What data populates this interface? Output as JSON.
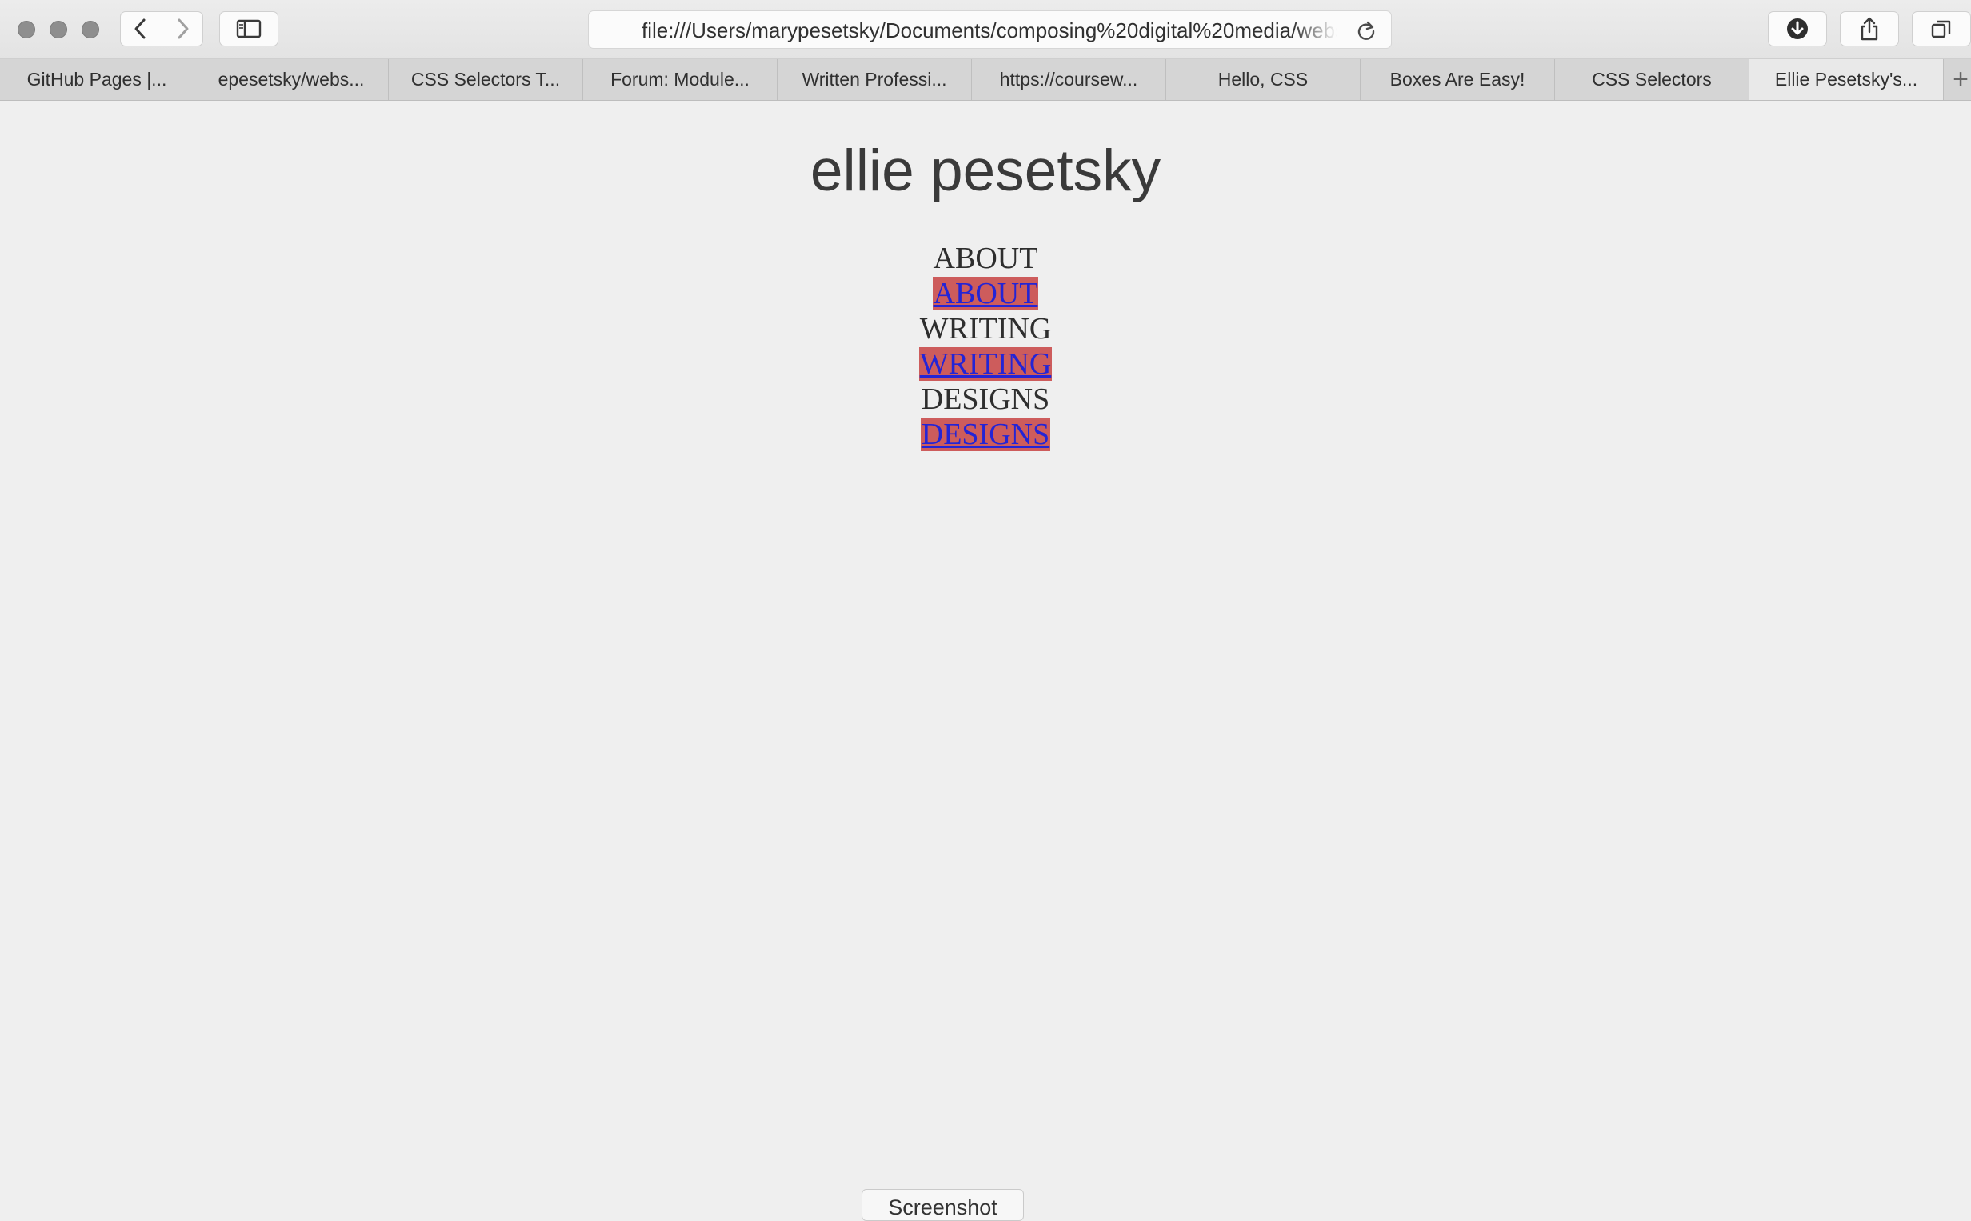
{
  "browser": {
    "address_url": "file:///Users/marypesetsky/Documents/composing%20digital%20media/webs",
    "tabs": [
      {
        "label": "GitHub Pages |...",
        "active": false
      },
      {
        "label": "epesetsky/webs...",
        "active": false
      },
      {
        "label": "CSS Selectors T...",
        "active": false
      },
      {
        "label": "Forum: Module...",
        "active": false
      },
      {
        "label": "Written Professi...",
        "active": false
      },
      {
        "label": "https://coursew...",
        "active": false
      },
      {
        "label": "Hello, CSS",
        "active": false
      },
      {
        "label": "Boxes Are Easy!",
        "active": false
      },
      {
        "label": "CSS Selectors",
        "active": false
      },
      {
        "label": "Ellie Pesetsky's...",
        "active": true
      }
    ],
    "new_tab_symbol": "+"
  },
  "page": {
    "title": "ellie pesetsky",
    "nav": [
      {
        "plain": "ABOUT",
        "link": "ABOUT"
      },
      {
        "plain": "WRITING",
        "link": "WRITING"
      },
      {
        "plain": "DESIGNS",
        "link": "DESIGNS"
      }
    ],
    "link_highlight_color": "#cd5c5c",
    "link_text_color": "#2424d6"
  },
  "overlay": {
    "screenshot_label": "Screenshot"
  },
  "icons": {
    "traffic_lights": [
      "close-icon",
      "minimize-icon",
      "zoom-icon"
    ],
    "toolbar": [
      "back-icon",
      "forward-icon",
      "sidebar-icon",
      "reload-icon",
      "download-icon",
      "share-icon",
      "tabs-overview-icon"
    ]
  }
}
